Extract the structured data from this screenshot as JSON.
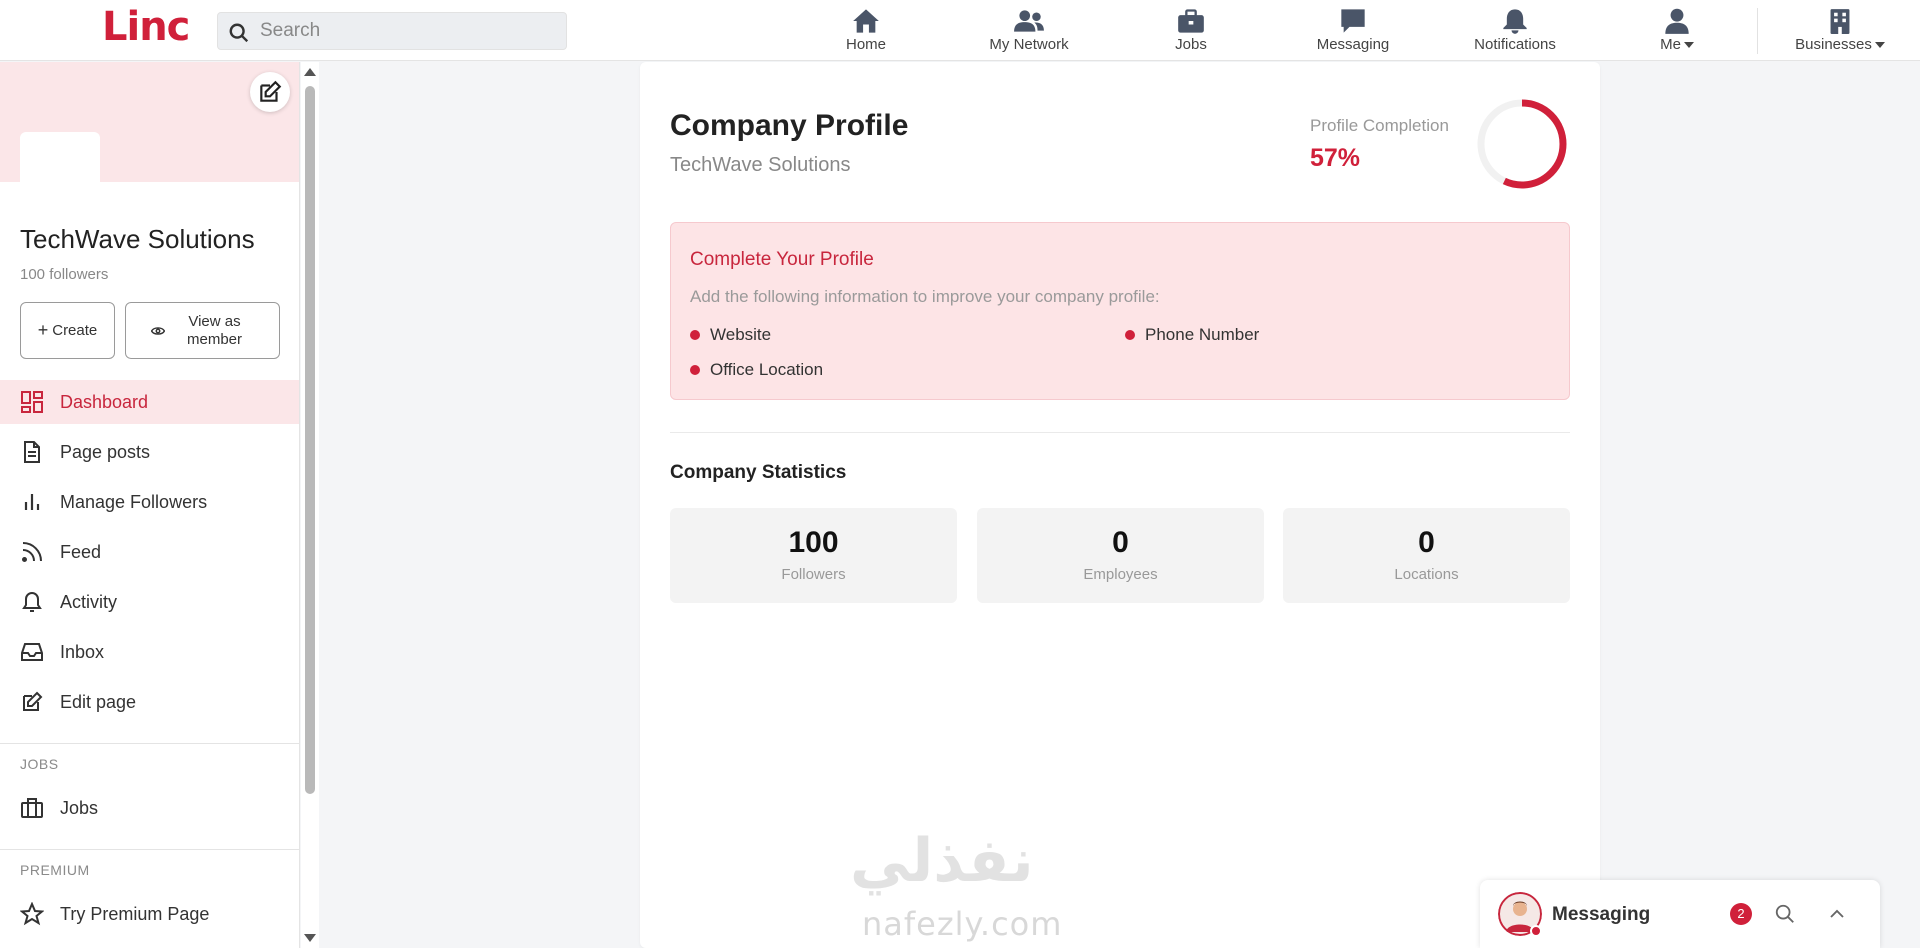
{
  "app": {
    "logo": "Linc"
  },
  "search": {
    "placeholder": "Search"
  },
  "nav": {
    "items": [
      {
        "label": "Home",
        "icon": "home-icon"
      },
      {
        "label": "My Network",
        "icon": "network-icon"
      },
      {
        "label": "Jobs",
        "icon": "briefcase-icon"
      },
      {
        "label": "Messaging",
        "icon": "message-icon"
      },
      {
        "label": "Notifications",
        "icon": "bell-icon"
      },
      {
        "label": "Me",
        "icon": "user-icon"
      },
      {
        "label": "Businesses",
        "icon": "building-icon"
      }
    ]
  },
  "sidebar": {
    "company_name": "TechWave Solutions",
    "followers": "100 followers",
    "create_label": "Create",
    "view_as_member_label": "View as member",
    "menu": [
      {
        "label": "Dashboard",
        "icon": "dashboard-icon",
        "active": true
      },
      {
        "label": "Page posts",
        "icon": "document-icon"
      },
      {
        "label": "Manage Followers",
        "icon": "bar-chart-icon"
      },
      {
        "label": "Feed",
        "icon": "rss-icon"
      },
      {
        "label": "Activity",
        "icon": "bell-icon"
      },
      {
        "label": "Inbox",
        "icon": "inbox-icon"
      },
      {
        "label": "Edit page",
        "icon": "edit-icon"
      }
    ],
    "jobs_section": {
      "title": "JOBS",
      "item": "Jobs"
    },
    "premium_section": {
      "title": "PREMIUM",
      "item": "Try Premium Page"
    }
  },
  "profile": {
    "title": "Company Profile",
    "subtitle": "TechWave Solutions",
    "completion_label": "Profile Completion",
    "completion_value": "57%",
    "completion_fraction": 0.57
  },
  "alert": {
    "title": "Complete Your Profile",
    "description": "Add the following information to improve your company profile:",
    "items": [
      "Website",
      "Phone Number",
      "Office Location"
    ]
  },
  "stats": {
    "title": "Company Statistics",
    "cards": [
      {
        "value": "100",
        "label": "Followers"
      },
      {
        "value": "0",
        "label": "Employees"
      },
      {
        "value": "0",
        "label": "Locations"
      }
    ]
  },
  "watermark": {
    "arabic": "نفذلي",
    "latin": "nafezly.com"
  },
  "messaging_widget": {
    "title": "Messaging",
    "badge": "2"
  },
  "colors": {
    "accent": "#d0203a",
    "accent_light": "#fde4e6"
  }
}
